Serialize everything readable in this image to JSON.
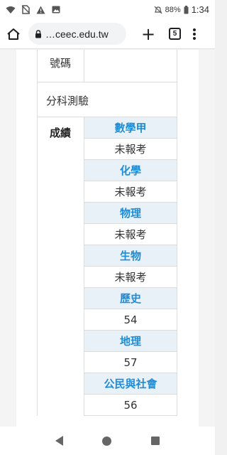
{
  "status_bar": {
    "battery": "88%",
    "time": "1:34"
  },
  "browser": {
    "url": "…ceec.edu.tw",
    "tab_count": "5"
  },
  "table": {
    "top_cell_label": "號碼",
    "section_title": "分科測驗",
    "scores_label": "成績",
    "subjects": [
      {
        "name": "數學甲",
        "score": "未報考"
      },
      {
        "name": "化學",
        "score": "未報考"
      },
      {
        "name": "物理",
        "score": "未報考"
      },
      {
        "name": "生物",
        "score": "未報考"
      },
      {
        "name": "歷史",
        "score": "54"
      },
      {
        "name": "地理",
        "score": "57"
      },
      {
        "name": "公民與社會",
        "score": "56"
      }
    ]
  },
  "icons": {
    "status_left": [
      "wifi-icon",
      "no-sim-icon",
      "warning-icon",
      "image-icon"
    ],
    "status_right": [
      "mute-icon",
      "battery-icon"
    ],
    "browser": [
      "home-icon",
      "lock-icon",
      "plus-icon",
      "tabs-icon",
      "more-vert-icon"
    ],
    "nav": [
      "back-icon",
      "home-circle-icon",
      "recents-icon"
    ]
  },
  "colors": {
    "subject_text": "#1f8cd6",
    "subject_bg": "#e8f1f8"
  }
}
